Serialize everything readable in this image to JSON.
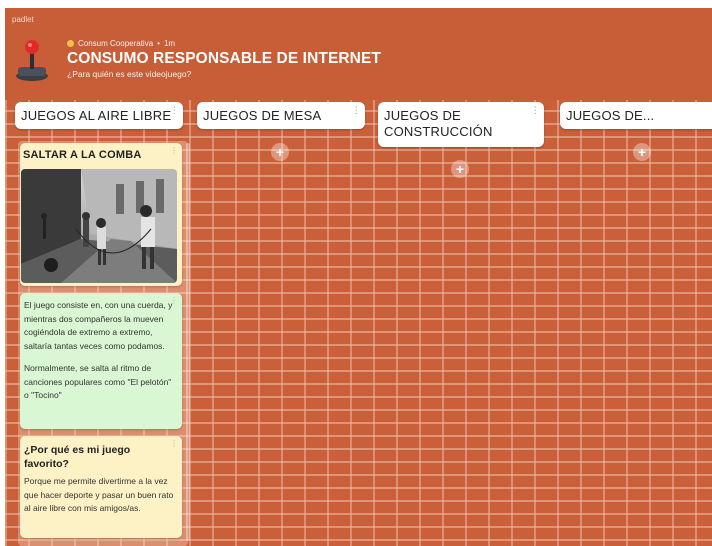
{
  "app": {
    "brand": "padlet"
  },
  "header": {
    "author": "Consum Cooperativa",
    "separator": "•",
    "time": "1m",
    "title": "CONSUMO RESPONSABLE DE INTERNET",
    "subtitle": "¿Para quién es este videojuego?"
  },
  "columns": [
    {
      "title": "JUEGOS AL AIRE LIBRE",
      "menu": "⋮"
    },
    {
      "title": "JUEGOS DE MESA",
      "menu": "⋮",
      "add": "+"
    },
    {
      "title": "JUEGOS DE CONSTRUCCIÓN",
      "menu": "⋮",
      "add": "+"
    },
    {
      "title": "JUEGOS DE...",
      "add": "+"
    }
  ],
  "posts": {
    "saltar": {
      "title": "SALTAR A LA COMBA",
      "menu": "⋮",
      "image": "black-and-white photo of children jumping rope on a street"
    },
    "description": {
      "menu": "⋮",
      "p1": "El juego consiste en, con una cuerda, y mientras dos compañeros la mueven cogiéndola de extremo a extremo, saltaría tantas veces como podamos.",
      "p2": "Normalmente, se salta al ritmo de canciones populares como \"El pelotón\" o \"Tocino\""
    },
    "favorite": {
      "menu": "⋮",
      "heading": "¿Por qué es mi juego favorito?",
      "body": "Porque me permite divertirme a la vez que hacer deporte y pasar un buen rato al aire libre con mis amigos/as."
    }
  },
  "colors": {
    "background": "#c9603a",
    "mortar": "#f0beaa",
    "card_yellow": "#fdf1c6",
    "card_green": "#d9f7d3"
  },
  "icons": {
    "logo": "joystick-icon",
    "author": "avatar-dot-icon",
    "add": "plus-icon",
    "menu": "kebab-icon"
  }
}
